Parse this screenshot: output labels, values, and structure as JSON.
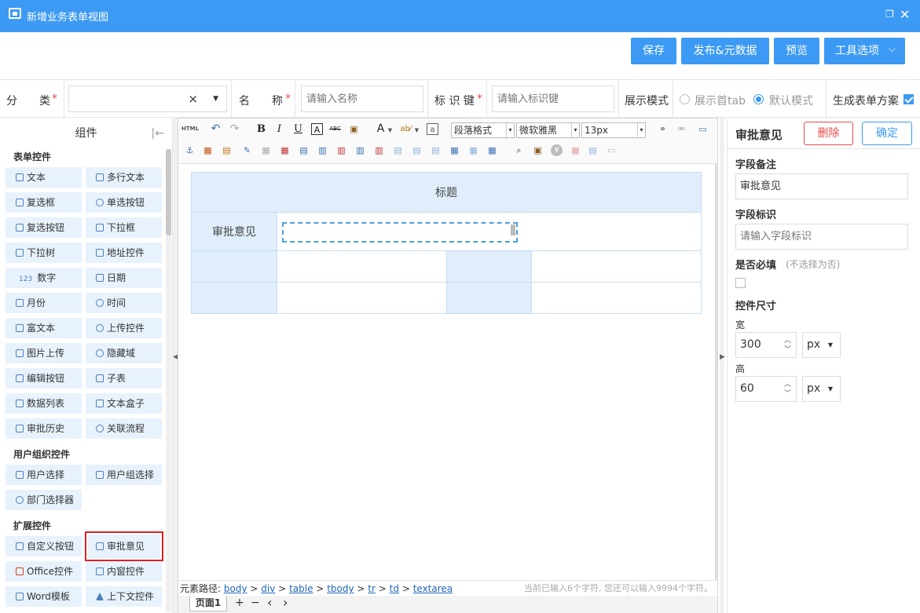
{
  "window": {
    "title": "新增业务表单视图",
    "restore_icon": "restore-icon",
    "close_icon": "close-icon"
  },
  "actions": {
    "save": "保存",
    "publish": "发布&元数据",
    "preview": "预览",
    "tools": "工具选项",
    "tools_caret": "⌵"
  },
  "form": {
    "category_label": "分　　类",
    "category_req": "*",
    "category_clear": "×",
    "name_label": "名　　称",
    "name_req": "*",
    "name_placeholder": "请输入名称",
    "key_label": "标 识 键",
    "key_req": "*",
    "key_placeholder": "请输入标识键",
    "display_mode_label": "展示模式",
    "mode_first_tab": "展示首tab",
    "mode_default": "默认模式",
    "mode_selected": "默认模式",
    "gen_scheme_label": "生成表单方案",
    "gen_scheme_checked": true
  },
  "left": {
    "header": "组件",
    "collapse_icon": "|←",
    "sections": {
      "form": "表单控件",
      "user_org": "用户组织控件",
      "ext": "扩展控件"
    },
    "items": {
      "text": "文本",
      "multitext": "多行文本",
      "checkbox": "复选框",
      "radio": "单选按钮",
      "checkbtn": "复选按钮",
      "dropdown": "下拉框",
      "droptree": "下拉树",
      "address": "地址控件",
      "number": "数字",
      "date": "日期",
      "month": "月份",
      "time": "时间",
      "richtext": "富文本",
      "upload": "上传控件",
      "imgupload": "图片上传",
      "hidden": "隐藏域",
      "editbtn": "编辑按钮",
      "subtable": "子表",
      "datalist": "数据列表",
      "textbox": "文本盒子",
      "history": "审批历史",
      "relflow": "关联流程",
      "usersel": "用户选择",
      "groupsel": "用户组选择",
      "deptsel": "部门选择器",
      "custombtn": "自定义按钮",
      "approval": "审批意见",
      "office": "Office控件",
      "iframe": "内窗控件",
      "word": "Word模板",
      "context": "上下文控件"
    },
    "number_prefix": "123"
  },
  "editor": {
    "toolbar": {
      "html": "HTML",
      "para_format": "段落格式",
      "font": "微软雅黑",
      "size": "13px",
      "dd": "▾"
    },
    "doc": {
      "title": "标题",
      "approval_label": "审批意见"
    },
    "path": {
      "label": "元素路径:",
      "items": [
        "body",
        "div",
        "table",
        "tbody",
        "tr",
        "td",
        "textarea"
      ],
      "sep": ">"
    },
    "count": "当前已输入6个字符, 您还可以输入9994个字符。",
    "page": {
      "tab": "页面1",
      "add": "+",
      "remove": "−",
      "prev": "‹",
      "next": "›"
    }
  },
  "right": {
    "title": "审批意见",
    "delete": "删除",
    "confirm": "确定",
    "remark_label": "字段备注",
    "remark_value": "审批意见",
    "id_label": "字段标识",
    "id_placeholder": "请输入字段标识",
    "required_label": "是否必填",
    "required_hint": "(不选择为否)",
    "size_label": "控件尺寸",
    "width_label": "宽",
    "width_value": "300",
    "width_unit": "px",
    "height_label": "高",
    "height_value": "60",
    "height_unit": "px"
  },
  "colors": {
    "accent": "#3c9af4",
    "cell_bg": "#e0eefb",
    "danger": "#e84b4b"
  }
}
